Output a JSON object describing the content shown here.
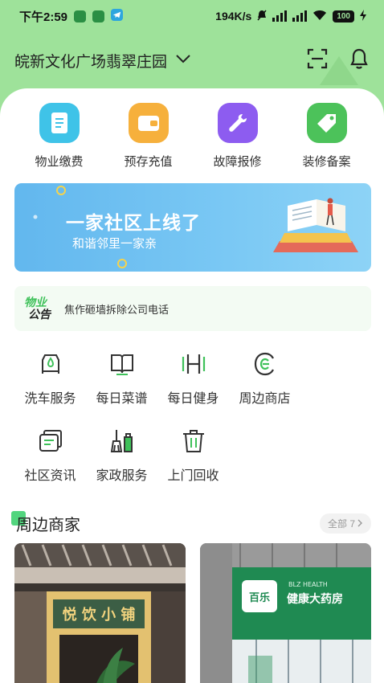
{
  "status_bar": {
    "time": "下午2:59",
    "net_speed": "194K/s",
    "battery": "100"
  },
  "header": {
    "community": "皖新文化广场翡翠庄园"
  },
  "quick_actions": [
    {
      "label": "物业缴费",
      "icon": "bill-icon",
      "color": "#3fc3e8"
    },
    {
      "label": "预存充值",
      "icon": "wallet-icon",
      "color": "#f6b03c"
    },
    {
      "label": "故障报修",
      "icon": "wrench-icon",
      "color": "#8d5cf0"
    },
    {
      "label": "装修备案",
      "icon": "tag-icon",
      "color": "#4cc25a"
    }
  ],
  "banner": {
    "title": "一家社区上线了",
    "subtitle": "和谐邻里一家亲"
  },
  "notice": {
    "logo_line1": "物业",
    "logo_line2": "公告",
    "text": "焦作砸墙拆除公司电话"
  },
  "services": [
    {
      "label": "洗车服务",
      "icon": "car-wash-icon"
    },
    {
      "label": "每日菜谱",
      "icon": "recipe-book-icon"
    },
    {
      "label": "每日健身",
      "icon": "dumbbell-icon"
    },
    {
      "label": "周边商店",
      "icon": "shop-icon"
    },
    {
      "label": "社区资讯",
      "icon": "news-icon"
    },
    {
      "label": "家政服务",
      "icon": "broom-icon"
    },
    {
      "label": "上门回收",
      "icon": "trash-icon"
    }
  ],
  "nearby": {
    "title": "周边商家",
    "see_all": "全部 7"
  },
  "colors": {
    "accent": "#3fc15a",
    "header_bg": "#9ee29a",
    "banner": "#6cbdf0"
  }
}
